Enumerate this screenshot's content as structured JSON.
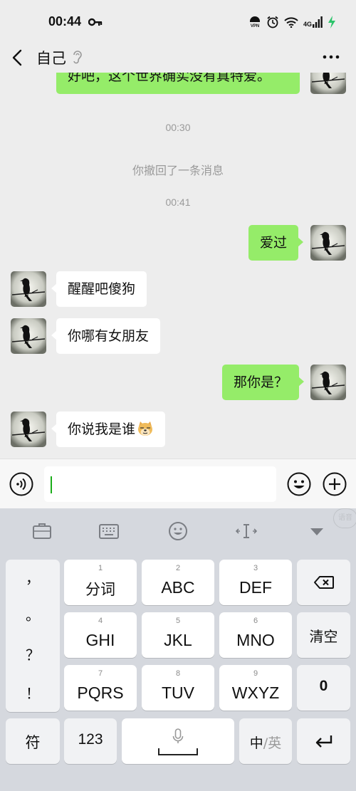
{
  "status_bar": {
    "time": "00:44",
    "network": "4G",
    "icons": [
      "key-icon",
      "vpn-icon",
      "alarm-icon",
      "wifi-icon",
      "signal-icon",
      "charging-icon"
    ]
  },
  "nav": {
    "title": "自己",
    "icons": [
      "back-icon",
      "ear-icon",
      "more-icon"
    ]
  },
  "chat": {
    "partial_message": "好吧，这个世界确实没有真特爱。",
    "time_1": "00:30",
    "system_message": "你撤回了一条消息",
    "time_2": "00:41",
    "messages": [
      {
        "side": "me",
        "text": "爱过"
      },
      {
        "side": "them",
        "text": "醒醒吧傻狗"
      },
      {
        "side": "them",
        "text": "你哪有女朋友"
      },
      {
        "side": "me",
        "text": "那你是？"
      },
      {
        "side": "them",
        "text": "你说我是谁",
        "emoji": "doge-emoji"
      }
    ]
  },
  "input": {
    "value": "",
    "icons": [
      "voice-icon",
      "emoji-icon",
      "plus-icon"
    ]
  },
  "keyboard": {
    "toolbar_icons": [
      "toolbox-icon",
      "keyboard-icon",
      "emoji-icon",
      "cursor-icon",
      "collapse-icon"
    ],
    "toolbar_badge": "语音",
    "punctuation": [
      "，",
      "。",
      "？",
      "！"
    ],
    "rows": [
      [
        {
          "num": "1",
          "label": "分词"
        },
        {
          "num": "2",
          "label": "ABC"
        },
        {
          "num": "3",
          "label": "DEF"
        }
      ],
      [
        {
          "num": "4",
          "label": "GHI"
        },
        {
          "num": "5",
          "label": "JKL"
        },
        {
          "num": "6",
          "label": "MNO"
        }
      ],
      [
        {
          "num": "7",
          "label": "PQRS"
        },
        {
          "num": "8",
          "label": "TUV"
        },
        {
          "num": "9",
          "label": "WXYZ"
        }
      ]
    ],
    "clear_label": "清空",
    "zero_label": "0",
    "symbol_label": "符",
    "number_label": "123",
    "lang_cn": "中",
    "lang_sep": "/",
    "lang_en": "英"
  },
  "colors": {
    "my_bubble": "#95ec69",
    "their_bubble": "#ffffff",
    "chat_background": "#ededed",
    "keyboard_background": "#d5d8de",
    "caret": "#1aad19"
  }
}
